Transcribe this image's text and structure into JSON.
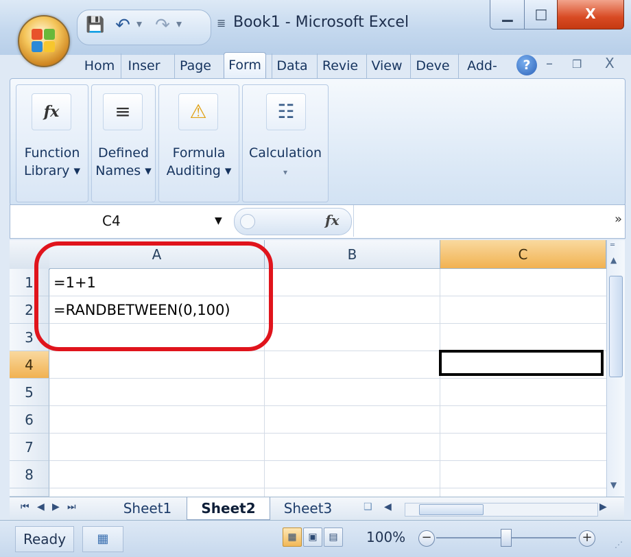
{
  "window": {
    "title": "Book1 - Microsoft Excel",
    "controls": {
      "minimize": "▁",
      "maximize": "□",
      "close": "X"
    }
  },
  "quick_access": {
    "save_icon": "save-icon",
    "undo_icon": "undo-icon",
    "redo_icon": "redo-icon",
    "dropdown": "▾",
    "more": "▾"
  },
  "ribbon_tabs": [
    {
      "label": "Hom"
    },
    {
      "label": "Inser"
    },
    {
      "label": "Page"
    },
    {
      "label": "Form"
    },
    {
      "label": "Data"
    },
    {
      "label": "Revie"
    },
    {
      "label": "View"
    },
    {
      "label": "Deve"
    },
    {
      "label": "Add-"
    }
  ],
  "active_tab": "Form",
  "ribbon_extras": {
    "help": "?",
    "minimize": "–",
    "restore": "❐",
    "close": "X"
  },
  "ribbon_groups": [
    {
      "line1": "Function",
      "line2": "Library ▾",
      "icon": "fx-icon",
      "icon_glyph": "fx"
    },
    {
      "line1": "Defined",
      "line2": "Names ▾",
      "icon": "defined-names-icon",
      "icon_glyph": "≡"
    },
    {
      "line1": "Formula",
      "line2": "Auditing ▾",
      "icon": "formula-auditing-icon",
      "icon_glyph": "⚠"
    },
    {
      "line1": "Calculation",
      "line2": "▾",
      "icon": "calculator-icon",
      "icon_glyph": "☷"
    }
  ],
  "formula_bar": {
    "name_box": "C4",
    "name_arrow": "▼",
    "fx": "fx",
    "formula": "",
    "expand": "»"
  },
  "grid": {
    "columns": [
      "A",
      "B",
      "C"
    ],
    "selected_column": "C",
    "rows": [
      "1",
      "2",
      "3",
      "4",
      "5",
      "6",
      "7",
      "8"
    ],
    "selected_row": "4",
    "cells": {
      "A1": "=1+1",
      "A2": "=RANDBETWEEN(0,100)"
    },
    "active_cell": "C4"
  },
  "sheet_tabs": [
    {
      "label": "Sheet1",
      "active": false
    },
    {
      "label": "Sheet2",
      "active": true
    },
    {
      "label": "Sheet3",
      "active": false
    }
  ],
  "sheet_nav": {
    "first": "⏮",
    "prev": "◀",
    "next": "▶",
    "last": "⏭"
  },
  "status": {
    "text": "Ready",
    "zoom": "100%",
    "zoom_out": "−",
    "zoom_in": "+"
  },
  "colors": {
    "highlight_ring": "#e0141c",
    "selected_header": "#f1b251",
    "ribbon": "#dbe8f6"
  }
}
